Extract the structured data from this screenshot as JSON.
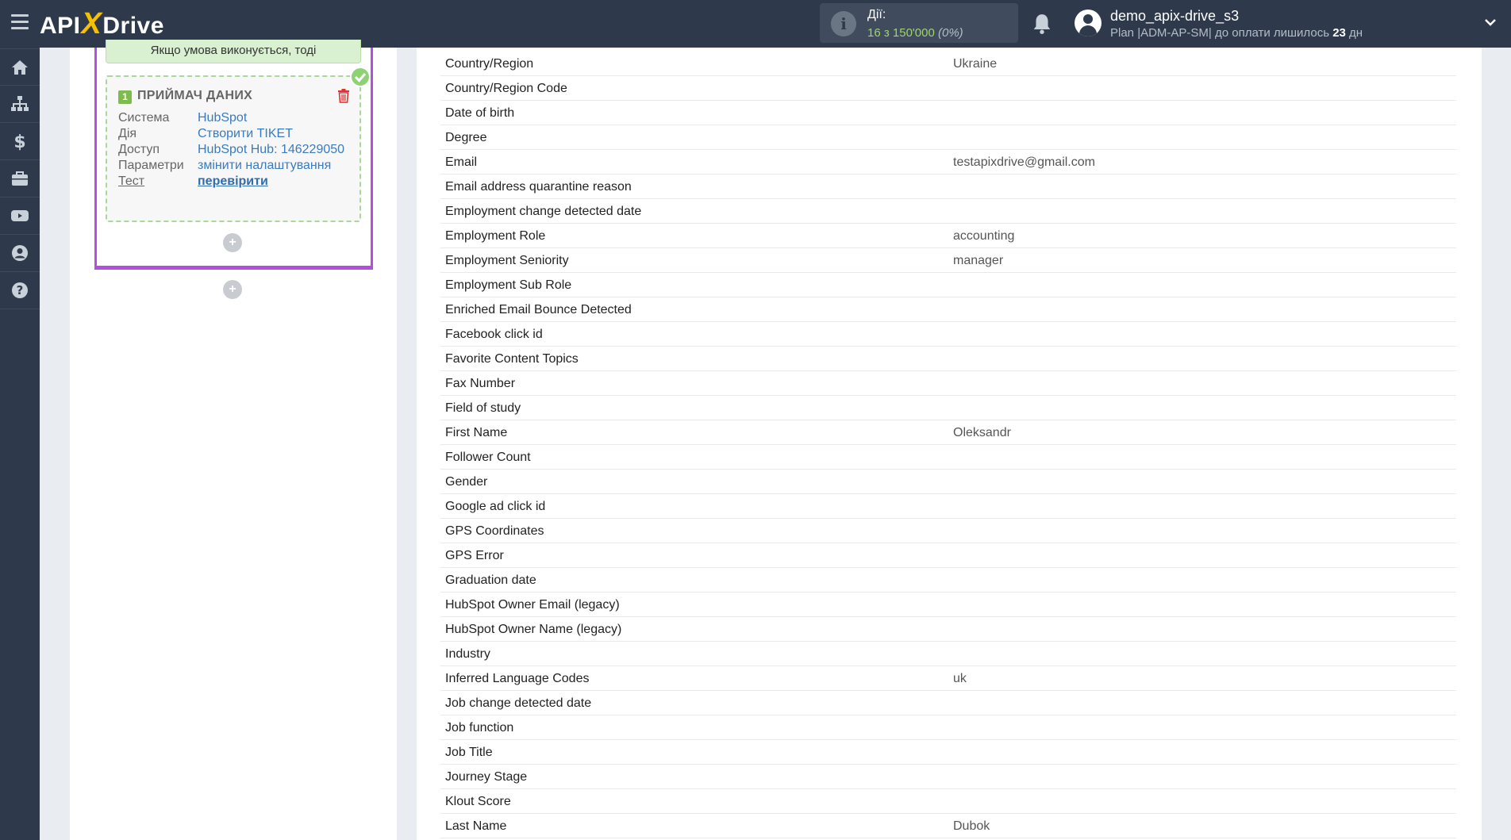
{
  "header": {
    "logo_left": "API",
    "logo_x": "X",
    "logo_right": "Drive",
    "actions_label": "Дії:",
    "actions_count": "16 з 150'000",
    "actions_pct": "(0%)",
    "user_name": "demo_apix-drive_s3",
    "plan_prefix": "Plan |ADM-AP-SM| до оплати лишилось ",
    "plan_days": "23",
    "plan_suffix": " дн"
  },
  "sidebar": {
    "items": [
      {
        "icon": "home-icon"
      },
      {
        "icon": "sitemap-icon"
      },
      {
        "icon": "dollar-icon"
      },
      {
        "icon": "briefcase-icon"
      },
      {
        "icon": "youtube-icon"
      },
      {
        "icon": "user-circle-icon"
      },
      {
        "icon": "question-icon"
      }
    ]
  },
  "flow": {
    "condition_text": "Якщо умова виконується, тоді",
    "receiver": {
      "number": "1",
      "title": "ПРИЙМАЧ ДАНИХ",
      "rows": [
        {
          "label": "Система",
          "value": "HubSpot"
        },
        {
          "label": "Дія",
          "value": "Створити TIKET"
        },
        {
          "label": "Доступ",
          "value": "HubSpot Hub: 146229050"
        },
        {
          "label": "Параметри",
          "value": "змінити налаштування"
        },
        {
          "label": "Тест",
          "value": "перевірити"
        }
      ]
    },
    "plus": "+"
  },
  "fields": [
    {
      "key": "Country/Region",
      "value": "Ukraine"
    },
    {
      "key": "Country/Region Code",
      "value": ""
    },
    {
      "key": "Date of birth",
      "value": ""
    },
    {
      "key": "Degree",
      "value": ""
    },
    {
      "key": "Email",
      "value": "testapixdrive@gmail.com"
    },
    {
      "key": "Email address quarantine reason",
      "value": ""
    },
    {
      "key": "Employment change detected date",
      "value": ""
    },
    {
      "key": "Employment Role",
      "value": "accounting"
    },
    {
      "key": "Employment Seniority",
      "value": "manager"
    },
    {
      "key": "Employment Sub Role",
      "value": ""
    },
    {
      "key": "Enriched Email Bounce Detected",
      "value": ""
    },
    {
      "key": "Facebook click id",
      "value": ""
    },
    {
      "key": "Favorite Content Topics",
      "value": ""
    },
    {
      "key": "Fax Number",
      "value": ""
    },
    {
      "key": "Field of study",
      "value": ""
    },
    {
      "key": "First Name",
      "value": "Oleksandr"
    },
    {
      "key": "Follower Count",
      "value": ""
    },
    {
      "key": "Gender",
      "value": ""
    },
    {
      "key": "Google ad click id",
      "value": ""
    },
    {
      "key": "GPS Coordinates",
      "value": ""
    },
    {
      "key": "GPS Error",
      "value": ""
    },
    {
      "key": "Graduation date",
      "value": ""
    },
    {
      "key": "HubSpot Owner Email (legacy)",
      "value": ""
    },
    {
      "key": "HubSpot Owner Name (legacy)",
      "value": ""
    },
    {
      "key": "Industry",
      "value": ""
    },
    {
      "key": "Inferred Language Codes",
      "value": "uk"
    },
    {
      "key": "Job change detected date",
      "value": ""
    },
    {
      "key": "Job function",
      "value": ""
    },
    {
      "key": "Job Title",
      "value": ""
    },
    {
      "key": "Journey Stage",
      "value": ""
    },
    {
      "key": "Klout Score",
      "value": ""
    },
    {
      "key": "Last Name",
      "value": "Dubok"
    }
  ]
}
